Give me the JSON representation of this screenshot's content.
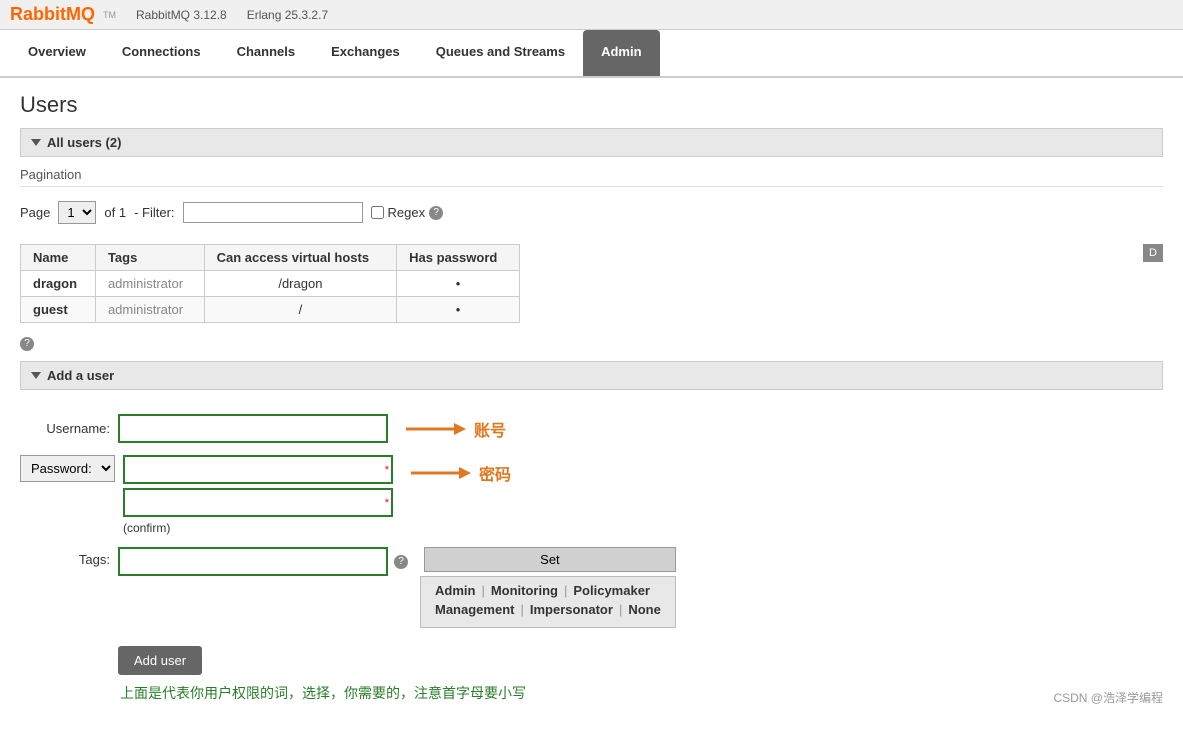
{
  "topbar": {
    "logo": "RabbitMQ",
    "tm": "TM",
    "version": "RabbitMQ 3.12.8",
    "erlang": "Erlang 25.3.2.7"
  },
  "nav": {
    "items": [
      {
        "id": "overview",
        "label": "Overview",
        "active": false
      },
      {
        "id": "connections",
        "label": "Connections",
        "active": false
      },
      {
        "id": "channels",
        "label": "Channels",
        "active": false
      },
      {
        "id": "exchanges",
        "label": "Exchanges",
        "active": false
      },
      {
        "id": "queues",
        "label": "Queues and Streams",
        "active": false
      },
      {
        "id": "admin",
        "label": "Admin",
        "active": true
      }
    ]
  },
  "page": {
    "title": "Users",
    "all_users_label": "All users (2)"
  },
  "pagination": {
    "label": "Pagination",
    "page_label": "Page",
    "page_value": "1",
    "of_text": "of 1",
    "filter_label": "- Filter:",
    "filter_placeholder": "",
    "regex_label": "Regex"
  },
  "table": {
    "headers": [
      "Name",
      "Tags",
      "Can access virtual hosts",
      "Has password"
    ],
    "rows": [
      {
        "name": "dragon",
        "tags": "administrator",
        "vhosts": "/dragon",
        "has_password": true
      },
      {
        "name": "guest",
        "tags": "administrator",
        "vhosts": "/",
        "has_password": true
      }
    ]
  },
  "add_user": {
    "section_label": "Add a user",
    "username_label": "Username:",
    "password_label": "Password:",
    "confirm_text": "(confirm)",
    "tags_label": "Tags:",
    "set_btn": "Set",
    "tag_options_row1": [
      "Admin",
      "|",
      "Monitoring",
      "|",
      "Policymaker"
    ],
    "tag_options_row2": [
      "Management",
      "|",
      "Impersonator",
      "|",
      "None"
    ],
    "add_btn": "Add user",
    "annotation_username": "账号",
    "annotation_password": "密码",
    "annotation_bottom": "上面是代表你用户权限的词，选择，你需要的，注意首字母要小写"
  },
  "csdn": {
    "credit": "CSDN @浩泽学编程"
  }
}
